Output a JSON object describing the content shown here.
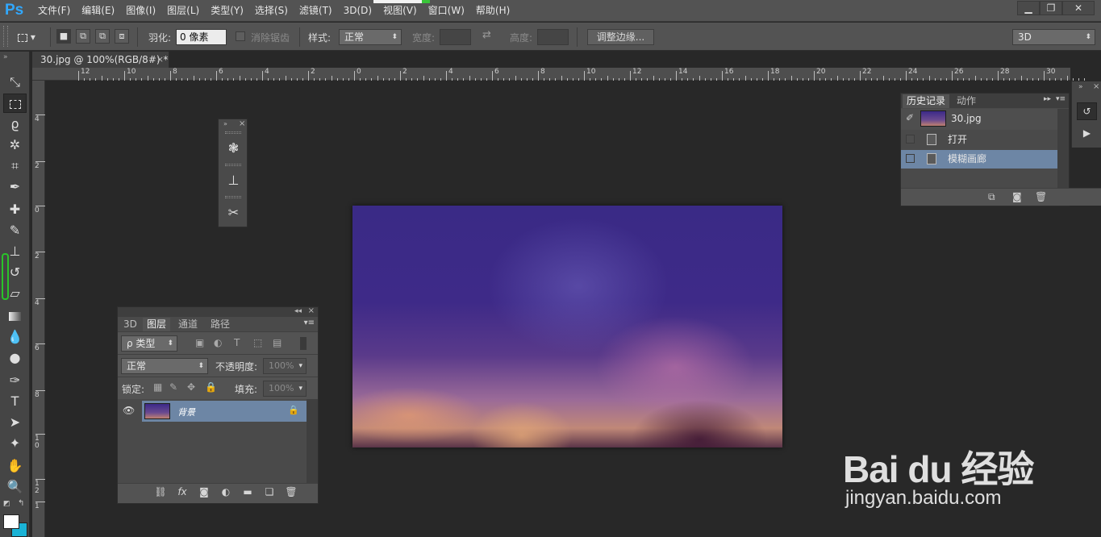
{
  "app": {
    "logo": "Ps"
  },
  "menubar": {
    "items": [
      "文件(F)",
      "编辑(E)",
      "图像(I)",
      "图层(L)",
      "类型(Y)",
      "选择(S)",
      "滤镜(T)",
      "3D(D)",
      "视图(V)",
      "窗口(W)",
      "帮助(H)"
    ],
    "minimize": "▁",
    "restore": "❐",
    "close": "✕"
  },
  "options": {
    "feather_label": "羽化:",
    "feather_value": "0 像素",
    "antialias_label": "消除锯齿",
    "style_label": "样式:",
    "style_value": "正常",
    "width_label": "宽度:",
    "height_label": "高度:",
    "refine_edge": "调整边缘...",
    "workspace": "3D"
  },
  "document": {
    "tab_title": "30.jpg @ 100%(RGB/8#) *",
    "tab_close": "×"
  },
  "ruler_top": [
    "12",
    "10",
    "8",
    "6",
    "4",
    "2",
    "0",
    "2",
    "4",
    "6",
    "8",
    "10",
    "12",
    "14",
    "16",
    "18",
    "20",
    "22",
    "24",
    "26",
    "28",
    "30"
  ],
  "ruler_left": [
    "4",
    "2",
    "0",
    "2",
    "4",
    "6",
    "8",
    "1\n0",
    "1\n2",
    "1"
  ],
  "layers_panel": {
    "tabs": [
      "3D",
      "图层",
      "通道",
      "路径"
    ],
    "active_tab": "图层",
    "filter_label": "ρ 类型",
    "blend_mode": "正常",
    "opacity_label": "不透明度:",
    "opacity_value": "100%",
    "lock_label": "锁定:",
    "fill_label": "填充:",
    "fill_value": "100%",
    "layers": [
      {
        "name": "背景",
        "visible": true,
        "locked": true
      }
    ],
    "footer_icons": [
      "link-icon",
      "fx-icon",
      "mask-icon",
      "adjustment-icon",
      "folder-icon",
      "new-layer-icon",
      "trash-icon"
    ],
    "fx_text": "fx"
  },
  "history_panel": {
    "tabs": [
      "历史记录",
      "动作"
    ],
    "active_tab": "历史记录",
    "snapshot": "30.jpg",
    "items": [
      {
        "label": "打开",
        "selected": false
      },
      {
        "label": "模糊画廊",
        "selected": true
      }
    ]
  },
  "watermark": {
    "logo": "Bai du 经验",
    "url": "jingyan.baidu.com"
  }
}
